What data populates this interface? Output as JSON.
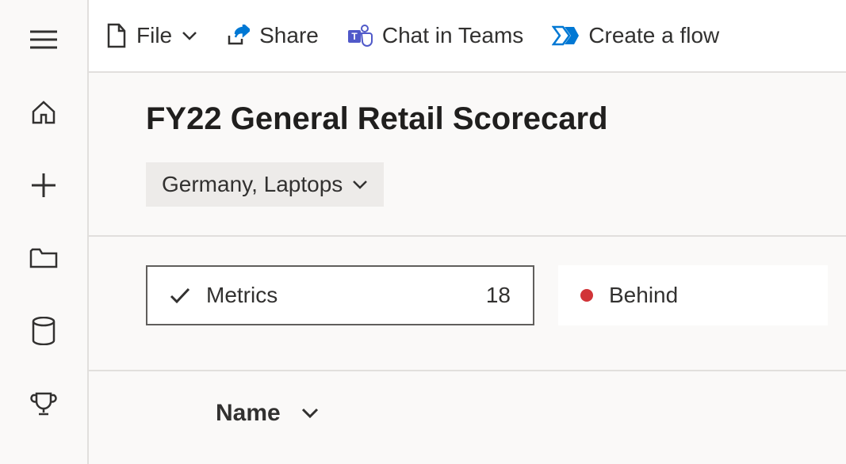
{
  "toolbar": {
    "file": "File",
    "share": "Share",
    "chat": "Chat in Teams",
    "flow": "Create a flow"
  },
  "header": {
    "title": "FY22 General Retail Scorecard",
    "filter": "Germany, Laptops"
  },
  "cards": {
    "metrics_label": "Metrics",
    "metrics_count": "18",
    "behind_label": "Behind"
  },
  "table": {
    "col_name": "Name"
  }
}
